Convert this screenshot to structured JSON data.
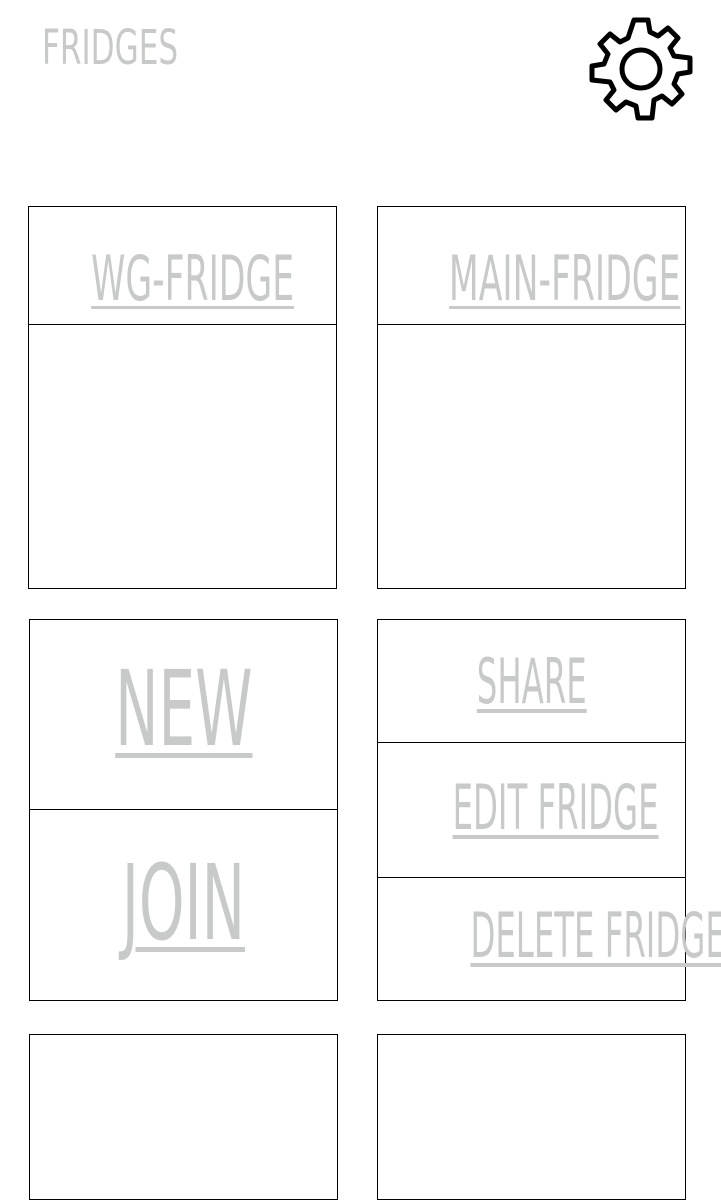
{
  "header": {
    "title": "FRIDGES",
    "settings_icon": "gear-icon"
  },
  "fridges": [
    {
      "name": "WG-FRIDGE"
    },
    {
      "name": "MAIN-FRIDGE"
    }
  ],
  "actions": {
    "new_label": "NEW",
    "join_label": "JOIN",
    "share_label": "SHARE",
    "edit_label": "EDIT FRIDGE",
    "delete_label": "DELETE FRIDGE"
  },
  "colors": {
    "text": "#c8cac9",
    "border": "#000000",
    "background": "#ffffff"
  }
}
